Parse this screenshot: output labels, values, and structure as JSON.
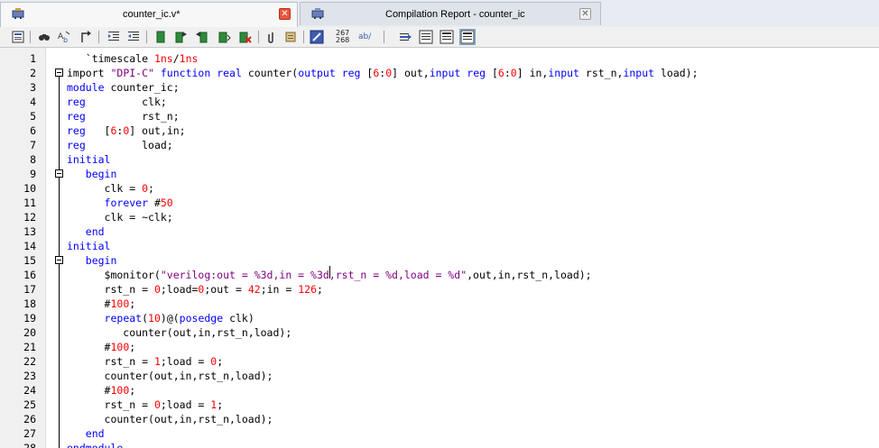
{
  "tabs": [
    {
      "label": "counter_ic.v*",
      "active": true,
      "icon": "verilog-file-icon"
    },
    {
      "label": "Compilation Report - counter_ic",
      "active": false,
      "icon": "compilation-report-icon"
    }
  ],
  "toolbar": {
    "line_numbers_top": "267",
    "line_numbers_bottom": "268",
    "replace_label": "ab/"
  },
  "colors": {
    "keyword": "#0000ff",
    "string": "#800080",
    "number": "#ff0000"
  },
  "editor": {
    "lines": [
      {
        "n": "1",
        "fold": "",
        "code": [
          {
            "t": "   `timescale ",
            "c": ""
          },
          {
            "t": "1ns",
            "c": "num"
          },
          {
            "t": "/",
            "c": ""
          },
          {
            "t": "1ns",
            "c": "num"
          }
        ]
      },
      {
        "n": "2",
        "fold": "box",
        "code": [
          {
            "t": "import ",
            "c": ""
          },
          {
            "t": "\"DPI-C\"",
            "c": "str"
          },
          {
            "t": " ",
            "c": ""
          },
          {
            "t": "function",
            "c": "kw"
          },
          {
            "t": " ",
            "c": ""
          },
          {
            "t": "real",
            "c": "kw"
          },
          {
            "t": " counter(",
            "c": ""
          },
          {
            "t": "output",
            "c": "kw"
          },
          {
            "t": " ",
            "c": ""
          },
          {
            "t": "reg",
            "c": "kw"
          },
          {
            "t": " [",
            "c": ""
          },
          {
            "t": "6",
            "c": "num"
          },
          {
            "t": ":",
            "c": ""
          },
          {
            "t": "0",
            "c": "num"
          },
          {
            "t": "] out,",
            "c": ""
          },
          {
            "t": "input",
            "c": "kw"
          },
          {
            "t": " ",
            "c": ""
          },
          {
            "t": "reg",
            "c": "kw"
          },
          {
            "t": " [",
            "c": ""
          },
          {
            "t": "6",
            "c": "num"
          },
          {
            "t": ":",
            "c": ""
          },
          {
            "t": "0",
            "c": "num"
          },
          {
            "t": "] in,",
            "c": ""
          },
          {
            "t": "input",
            "c": "kw"
          },
          {
            "t": " rst_n,",
            "c": ""
          },
          {
            "t": "input",
            "c": "kw"
          },
          {
            "t": " load);",
            "c": ""
          }
        ]
      },
      {
        "n": "3",
        "fold": "",
        "code": [
          {
            "t": "module",
            "c": "kw"
          },
          {
            "t": " counter_ic;",
            "c": ""
          }
        ]
      },
      {
        "n": "4",
        "fold": "",
        "code": [
          {
            "t": "reg",
            "c": "kw"
          },
          {
            "t": "         clk;",
            "c": ""
          }
        ]
      },
      {
        "n": "5",
        "fold": "",
        "code": [
          {
            "t": "reg",
            "c": "kw"
          },
          {
            "t": "         rst_n;",
            "c": ""
          }
        ]
      },
      {
        "n": "6",
        "fold": "",
        "code": [
          {
            "t": "reg",
            "c": "kw"
          },
          {
            "t": "   [",
            "c": ""
          },
          {
            "t": "6",
            "c": "num"
          },
          {
            "t": ":",
            "c": ""
          },
          {
            "t": "0",
            "c": "num"
          },
          {
            "t": "] out,in;",
            "c": ""
          }
        ]
      },
      {
        "n": "7",
        "fold": "",
        "code": [
          {
            "t": "reg",
            "c": "kw"
          },
          {
            "t": "         load;",
            "c": ""
          }
        ]
      },
      {
        "n": "8",
        "fold": "",
        "code": [
          {
            "t": "initial",
            "c": "kw"
          }
        ]
      },
      {
        "n": "9",
        "fold": "box",
        "code": [
          {
            "t": "   ",
            "c": ""
          },
          {
            "t": "begin",
            "c": "kw"
          }
        ]
      },
      {
        "n": "10",
        "fold": "",
        "code": [
          {
            "t": "      clk = ",
            "c": ""
          },
          {
            "t": "0",
            "c": "num"
          },
          {
            "t": ";",
            "c": ""
          }
        ]
      },
      {
        "n": "11",
        "fold": "",
        "code": [
          {
            "t": "      ",
            "c": ""
          },
          {
            "t": "forever",
            "c": "kw"
          },
          {
            "t": " #",
            "c": ""
          },
          {
            "t": "50",
            "c": "num"
          }
        ]
      },
      {
        "n": "12",
        "fold": "",
        "code": [
          {
            "t": "      clk = ~clk;",
            "c": ""
          }
        ]
      },
      {
        "n": "13",
        "fold": "",
        "code": [
          {
            "t": "   ",
            "c": ""
          },
          {
            "t": "end",
            "c": "kw"
          }
        ]
      },
      {
        "n": "14",
        "fold": "",
        "code": [
          {
            "t": "initial",
            "c": "kw"
          }
        ]
      },
      {
        "n": "15",
        "fold": "box",
        "code": [
          {
            "t": "   ",
            "c": ""
          },
          {
            "t": "begin",
            "c": "kw"
          }
        ]
      },
      {
        "n": "16",
        "fold": "",
        "code": [
          {
            "t": "      $monitor(",
            "c": ""
          },
          {
            "t": "\"verilog:out = %3d,in = %3d,rst_n = %d,load = %d\"",
            "c": "str"
          },
          {
            "t": ",out,in,rst_n,load);",
            "c": ""
          }
        ]
      },
      {
        "n": "17",
        "fold": "",
        "code": [
          {
            "t": "      rst_n = ",
            "c": ""
          },
          {
            "t": "0",
            "c": "num"
          },
          {
            "t": ";load=",
            "c": ""
          },
          {
            "t": "0",
            "c": "num"
          },
          {
            "t": ";out = ",
            "c": ""
          },
          {
            "t": "42",
            "c": "num"
          },
          {
            "t": ";in = ",
            "c": ""
          },
          {
            "t": "126",
            "c": "num"
          },
          {
            "t": ";",
            "c": ""
          }
        ]
      },
      {
        "n": "18",
        "fold": "",
        "code": [
          {
            "t": "      #",
            "c": ""
          },
          {
            "t": "100",
            "c": "num"
          },
          {
            "t": ";",
            "c": ""
          }
        ]
      },
      {
        "n": "19",
        "fold": "",
        "code": [
          {
            "t": "      ",
            "c": ""
          },
          {
            "t": "repeat",
            "c": "kw"
          },
          {
            "t": "(",
            "c": ""
          },
          {
            "t": "10",
            "c": "num"
          },
          {
            "t": ")@(",
            "c": ""
          },
          {
            "t": "posedge",
            "c": "kw"
          },
          {
            "t": " clk)",
            "c": ""
          }
        ]
      },
      {
        "n": "20",
        "fold": "",
        "code": [
          {
            "t": "         counter(out,in,rst_n,load);",
            "c": ""
          }
        ]
      },
      {
        "n": "21",
        "fold": "",
        "code": [
          {
            "t": "      #",
            "c": ""
          },
          {
            "t": "100",
            "c": "num"
          },
          {
            "t": ";",
            "c": ""
          }
        ]
      },
      {
        "n": "22",
        "fold": "",
        "code": [
          {
            "t": "      rst_n = ",
            "c": ""
          },
          {
            "t": "1",
            "c": "num"
          },
          {
            "t": ";load = ",
            "c": ""
          },
          {
            "t": "0",
            "c": "num"
          },
          {
            "t": ";",
            "c": ""
          }
        ]
      },
      {
        "n": "23",
        "fold": "",
        "code": [
          {
            "t": "      counter(out,in,rst_n,load);",
            "c": ""
          }
        ]
      },
      {
        "n": "24",
        "fold": "",
        "code": [
          {
            "t": "      #",
            "c": ""
          },
          {
            "t": "100",
            "c": "num"
          },
          {
            "t": ";",
            "c": ""
          }
        ]
      },
      {
        "n": "25",
        "fold": "",
        "code": [
          {
            "t": "      rst_n = ",
            "c": ""
          },
          {
            "t": "0",
            "c": "num"
          },
          {
            "t": ";load = ",
            "c": ""
          },
          {
            "t": "1",
            "c": "num"
          },
          {
            "t": ";",
            "c": ""
          }
        ]
      },
      {
        "n": "26",
        "fold": "",
        "code": [
          {
            "t": "      counter(out,in,rst_n,load);",
            "c": ""
          }
        ]
      },
      {
        "n": "27",
        "fold": "",
        "code": [
          {
            "t": "   ",
            "c": ""
          },
          {
            "t": "end",
            "c": "kw"
          }
        ]
      },
      {
        "n": "28",
        "fold": "",
        "code": [
          {
            "t": "endmodule",
            "c": "kw"
          }
        ]
      }
    ]
  }
}
